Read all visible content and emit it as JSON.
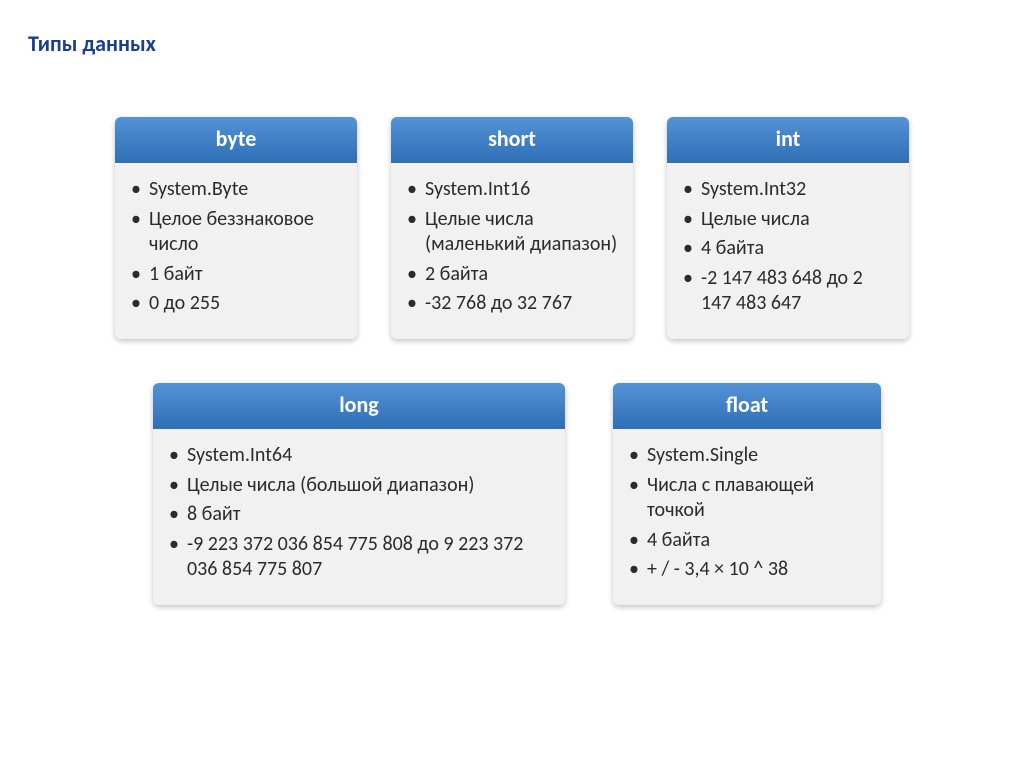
{
  "title": "Типы данных",
  "cards": {
    "byte": {
      "title": "byte",
      "items": [
        "System.Byte",
        "Целое беззнаковое число",
        "1 байт",
        "0 до 255"
      ]
    },
    "short": {
      "title": "short",
      "items": [
        "System.Int16",
        "Целые числа (маленький диапазон)",
        "2 байта",
        "-32 768 до 32 767"
      ]
    },
    "int": {
      "title": "int",
      "items": [
        "System.Int32",
        "Целые числа",
        "4 байта",
        "-2 147 483 648 до 2 147 483 647"
      ]
    },
    "long": {
      "title": "long",
      "items": [
        "System.Int64",
        "Целые числа (большой диапазон)",
        "8 байт",
        "-9 223 372 036 854 775 808 до 9 223 372 036 854 775 807"
      ]
    },
    "float": {
      "title": "float",
      "items": [
        "System.Single",
        "Числа с плавающей точкой",
        "4 байта",
        "+ / - 3,4 × 10 ^ 38"
      ]
    }
  }
}
